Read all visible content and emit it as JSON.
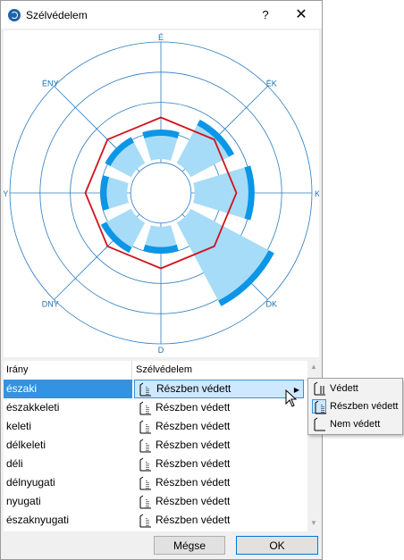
{
  "window": {
    "title": "Szélvédelem",
    "help_label": "?",
    "close_label": "✕"
  },
  "compass": {
    "labels": [
      "É",
      "ÉK",
      "K",
      "DK",
      "D",
      "DNY",
      "NY",
      "ÉNY"
    ]
  },
  "chart_data": {
    "type": "polar-bar",
    "directions": [
      "É",
      "ÉK",
      "K",
      "DK",
      "D",
      "DNY",
      "NY",
      "ÉNY"
    ],
    "series": [
      {
        "values": [
          0.42,
          0.55,
          0.62,
          0.85,
          0.4,
          0.45,
          0.4,
          0.42
        ]
      }
    ],
    "rings": 5
  },
  "table": {
    "headers": {
      "direction": "Irány",
      "protection": "Szélvédelem"
    },
    "rows": [
      {
        "direction": "északi",
        "protection": "Részben védett",
        "selected": true
      },
      {
        "direction": "északkeleti",
        "protection": "Részben védett"
      },
      {
        "direction": "keleti",
        "protection": "Részben védett"
      },
      {
        "direction": "délkeleti",
        "protection": "Részben védett"
      },
      {
        "direction": "déli",
        "protection": "Részben védett"
      },
      {
        "direction": "délnyugati",
        "protection": "Részben védett"
      },
      {
        "direction": "nyugati",
        "protection": "Részben védett"
      },
      {
        "direction": "északnyugati",
        "protection": "Részben védett"
      }
    ]
  },
  "popup": {
    "items": [
      {
        "label": "Védett",
        "icon": "protected-icon"
      },
      {
        "label": "Részben védett",
        "icon": "partially-protected-icon",
        "checked": true
      },
      {
        "label": "Nem védett",
        "icon": "unprotected-icon"
      }
    ]
  },
  "buttons": {
    "cancel": "Mégse",
    "ok": "OK"
  },
  "colors": {
    "accent": "#3393e0",
    "ring": "#2b7bbf",
    "bar_light": "#a6dcf7",
    "bar_dark": "#0b96e6",
    "outline": "#d0141c"
  }
}
